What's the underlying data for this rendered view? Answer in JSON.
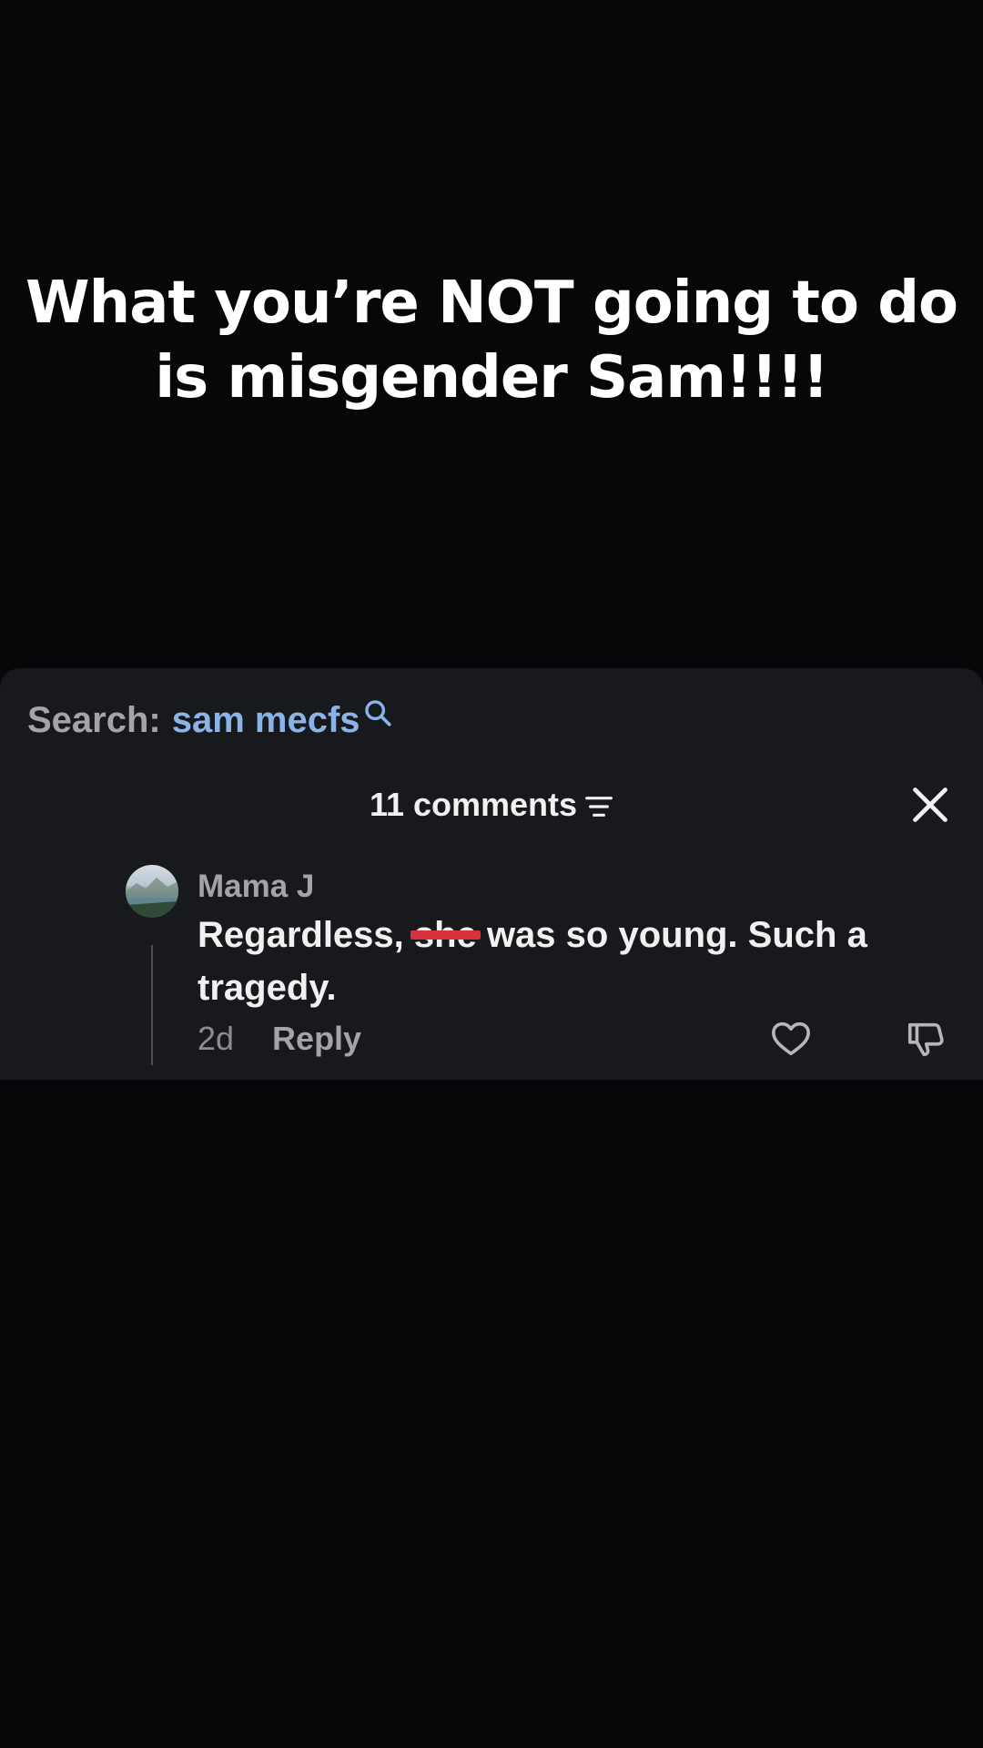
{
  "caption": {
    "line1": "What you’re NOT going to do",
    "line2": "is misgender Sam!!!!"
  },
  "search": {
    "label": "Search:",
    "query": "sam mecfs",
    "icon": "search-icon"
  },
  "comments_header": {
    "title": "11 comments",
    "sort_icon": "sort-icon",
    "close_icon": "close-icon"
  },
  "comment": {
    "username": "Mama J",
    "text_before": "Regardless, ",
    "text_struck": "she",
    "text_after": " was so young. Such a tragedy.",
    "timestamp": "2d",
    "reply_label": "Reply",
    "like_icon": "heart-icon",
    "dislike_icon": "thumbs-down-icon",
    "strike_color": "#d8323c"
  },
  "colors": {
    "background": "#060708",
    "panel": "#17191d",
    "search_query": "#8ab4e8"
  }
}
